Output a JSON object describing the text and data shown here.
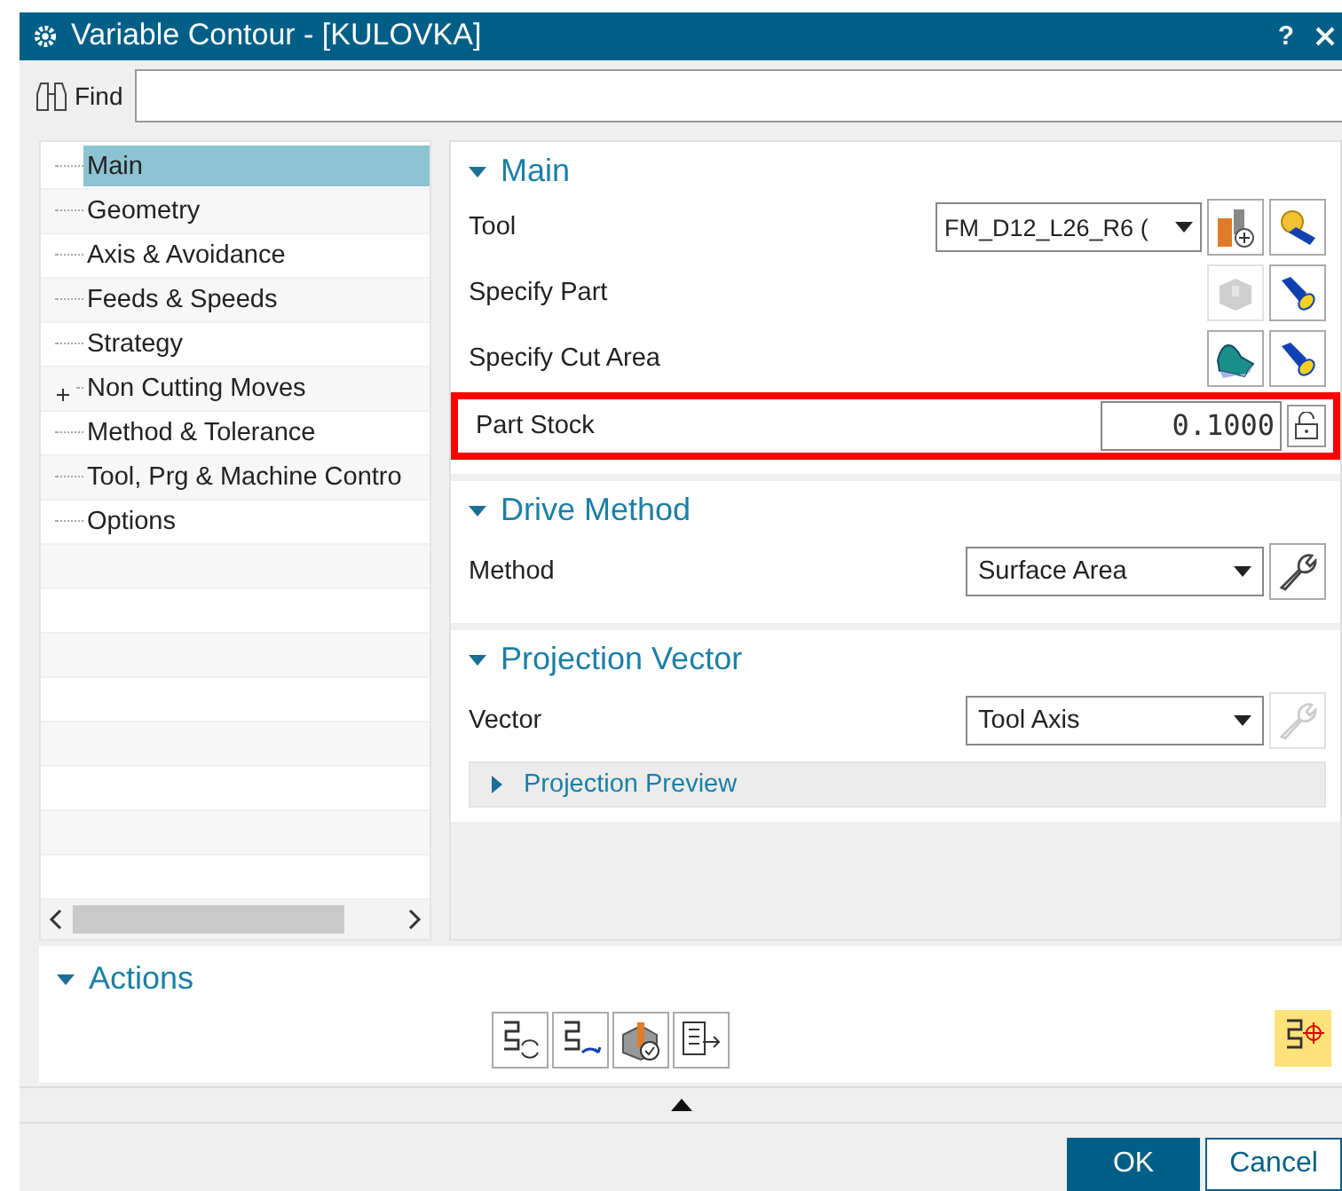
{
  "window": {
    "title": "Variable Contour - [KULOVKA]",
    "help": "?"
  },
  "find": {
    "label": "Find"
  },
  "tree": {
    "items": [
      {
        "label": "Main",
        "selected": true
      },
      {
        "label": "Geometry",
        "selected": false
      },
      {
        "label": "Axis & Avoidance",
        "selected": false
      },
      {
        "label": "Feeds & Speeds",
        "selected": false
      },
      {
        "label": "Strategy",
        "selected": false
      },
      {
        "label": "Non Cutting Moves",
        "selected": false,
        "expanded": false
      },
      {
        "label": "Method & Tolerance",
        "selected": false
      },
      {
        "label": "Tool, Prg & Machine Contro",
        "selected": false
      },
      {
        "label": "Options",
        "selected": false
      }
    ]
  },
  "sections": [
    {
      "title": "Main",
      "expanded": true,
      "rows": [
        {
          "kind": "tool",
          "label": "Tool",
          "value": "FM_D12_L26_R6 (",
          "highlighted": false,
          "buttons": [
            {
              "disabled": false
            },
            {
              "disabled": false
            }
          ]
        },
        {
          "kind": "part",
          "label": "Specify Part",
          "highlighted": false,
          "buttons": [
            {
              "disabled": true
            },
            {
              "disabled": false
            }
          ]
        },
        {
          "kind": "cut",
          "label": "Specify Cut Area",
          "highlighted": false,
          "buttons": [
            {
              "disabled": false
            },
            {
              "disabled": false
            }
          ]
        },
        {
          "kind": "number",
          "label": "Part Stock",
          "value": "0.1000",
          "highlighted": true
        }
      ]
    },
    {
      "title": "Drive Method",
      "expanded": true,
      "rows": [
        {
          "kind": "select",
          "label": "Method",
          "value": "Surface Area",
          "highlighted": false,
          "buttons": [
            {
              "disabled": false
            }
          ]
        }
      ]
    },
    {
      "title": "Projection Vector",
      "expanded": true,
      "rows": [
        {
          "kind": "select",
          "label": "Vector",
          "value": "Tool Axis",
          "highlighted": false,
          "buttons": [
            {
              "disabled": true
            }
          ]
        },
        {
          "kind": "subsection",
          "label": "Projection Preview",
          "expanded": false
        }
      ]
    }
  ],
  "actions": {
    "title": "Actions",
    "expanded": true,
    "buttons": [
      {
        "highlighted": false
      },
      {
        "highlighted": false
      },
      {
        "highlighted": false
      },
      {
        "highlighted": false
      },
      {
        "highlighted": true
      }
    ]
  },
  "buttons": [
    {
      "label": "OK",
      "primary": true
    },
    {
      "label": "Cancel",
      "primary": false
    }
  ]
}
